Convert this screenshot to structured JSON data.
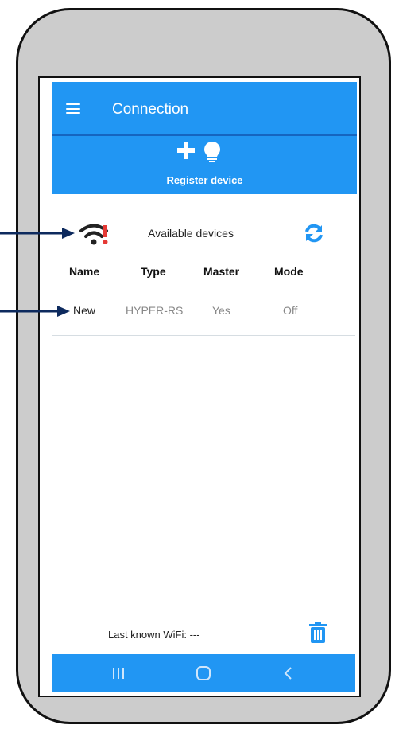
{
  "appbar": {
    "title": "Connection",
    "menu_icon": "hamburger-menu-icon"
  },
  "register": {
    "label": "Register device",
    "icons": [
      "plus-icon",
      "lightbulb-icon"
    ]
  },
  "devices": {
    "heading": "Available devices",
    "status_icon": "wifi-warning-icon",
    "refresh_icon": "refresh-icon",
    "columns": [
      "Name",
      "Type",
      "Master",
      "Mode"
    ],
    "rows": [
      {
        "name": "New",
        "type": "HYPER-RS",
        "master": "Yes",
        "mode": "Off"
      }
    ]
  },
  "footer": {
    "wifi_text": "Last known WiFi: ---",
    "delete_icon": "trash-icon"
  },
  "navbar": {
    "buttons": [
      "recent-apps-icon",
      "home-icon",
      "back-icon"
    ]
  },
  "colors": {
    "primary": "#2196f3",
    "warning": "#e53935",
    "phone_frame": "#cccccc",
    "arrow": "#0d2a5e"
  }
}
